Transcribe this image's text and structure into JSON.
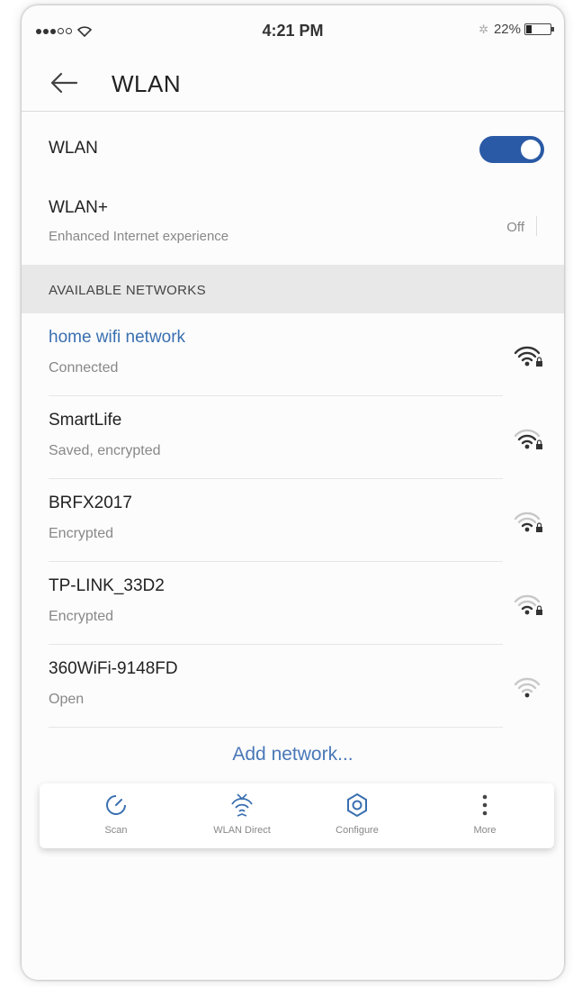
{
  "status_bar": {
    "time": "4:21 PM",
    "battery_percent": "22%",
    "battery_level": 0.22
  },
  "header": {
    "title": "WLAN"
  },
  "wlan": {
    "label": "WLAN",
    "enabled": true,
    "toggle_color": "#2a5aa5"
  },
  "wlan_plus": {
    "label": "WLAN+",
    "subtitle": "Enhanced Internet experience",
    "state": "Off"
  },
  "section": {
    "title": "AVAILABLE NETWORKS"
  },
  "networks": [
    {
      "name": "home wifi network",
      "status": "Connected",
      "signal_level": 1.0,
      "locked": true,
      "connected": true
    },
    {
      "name": "SmartLife",
      "status": "Saved, encrypted",
      "signal_level": 0.75,
      "locked": true,
      "connected": false
    },
    {
      "name": "BRFX2017",
      "status": "Encrypted",
      "signal_level": 0.5,
      "locked": true,
      "connected": false
    },
    {
      "name": "TP-LINK_33D2",
      "status": "Encrypted",
      "signal_level": 0.5,
      "locked": true,
      "connected": false
    },
    {
      "name": "360WiFi-9148FD",
      "status": "Open",
      "signal_level": 0.25,
      "locked": false,
      "connected": false
    }
  ],
  "add_network": "Add network...",
  "toolbar": {
    "scan": "Scan",
    "wlan_direct": "WLAN Direct",
    "configure": "Configure",
    "more": "More"
  },
  "colors": {
    "accent": "#3a6fb0",
    "link": "#4a78b8"
  }
}
